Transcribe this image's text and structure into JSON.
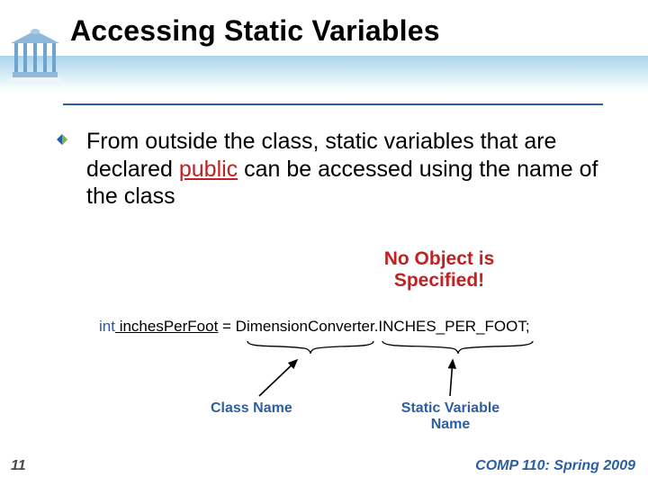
{
  "title": "Accessing Static Variables",
  "body_pre": "From outside the class, static variables that are declared ",
  "body_pub": "public",
  "body_post": " can be accessed using the name of the class",
  "callout_line1": "No Object is",
  "callout_line2": "Specified!",
  "code_kw": "int",
  "code_var": " inchesPerFoot",
  "code_rest": " = DimensionConverter.INCHES_PER_FOOT;",
  "label_class": "Class Name",
  "label_static_l1": "Static Variable",
  "label_static_l2": "Name",
  "page_number": "11",
  "course": "COMP 110: Spring 2009"
}
